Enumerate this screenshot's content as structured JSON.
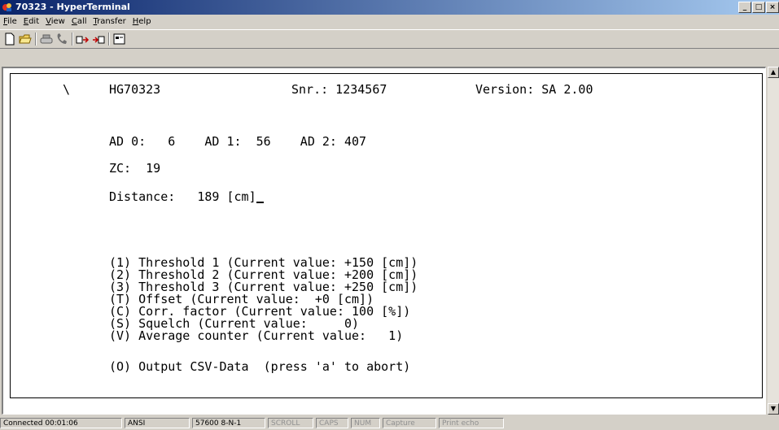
{
  "window": {
    "title": "70323 - HyperTerminal"
  },
  "menu": [
    "File",
    "Edit",
    "View",
    "Call",
    "Transfer",
    "Help"
  ],
  "menu_underline": [
    "F",
    "E",
    "V",
    "C",
    "T",
    "H"
  ],
  "toolbar": {
    "icons": [
      "new-icon",
      "open-icon",
      "disconnect-icon",
      "dial-icon",
      "send-icon",
      "receive-icon",
      "properties-icon"
    ]
  },
  "terminal": {
    "header": {
      "spinner": "\\",
      "device": "HG70323",
      "serial": "Snr.: 1234567",
      "version": "Version: SA 2.00"
    },
    "ad_line": "AD 0:   6    AD 1:  56    AD 2: 407",
    "zc_line": "ZC:  19",
    "distance_line": "Distance:   189 [cm]",
    "menu_lines": [
      "(1) Threshold 1 (Current value: +150 [cm])",
      "(2) Threshold 2 (Current value: +200 [cm])",
      "(3) Threshold 3 (Current value: +250 [cm])",
      "(T) Offset (Current value:  +0 [cm])",
      "(C) Corr. factor (Current value: 100 [%])",
      "(S) Squelch (Current value:     0)",
      "(V) Average counter (Current value:   1)"
    ],
    "output_line": "(O) Output CSV-Data  (press 'a' to abort)"
  },
  "status": {
    "connected": "Connected 00:01:06",
    "emulation": "ANSI",
    "settings": "57600 8-N-1",
    "scroll": "SCROLL",
    "caps": "CAPS",
    "num": "NUM",
    "capture": "Capture",
    "print_echo": "Print echo"
  }
}
